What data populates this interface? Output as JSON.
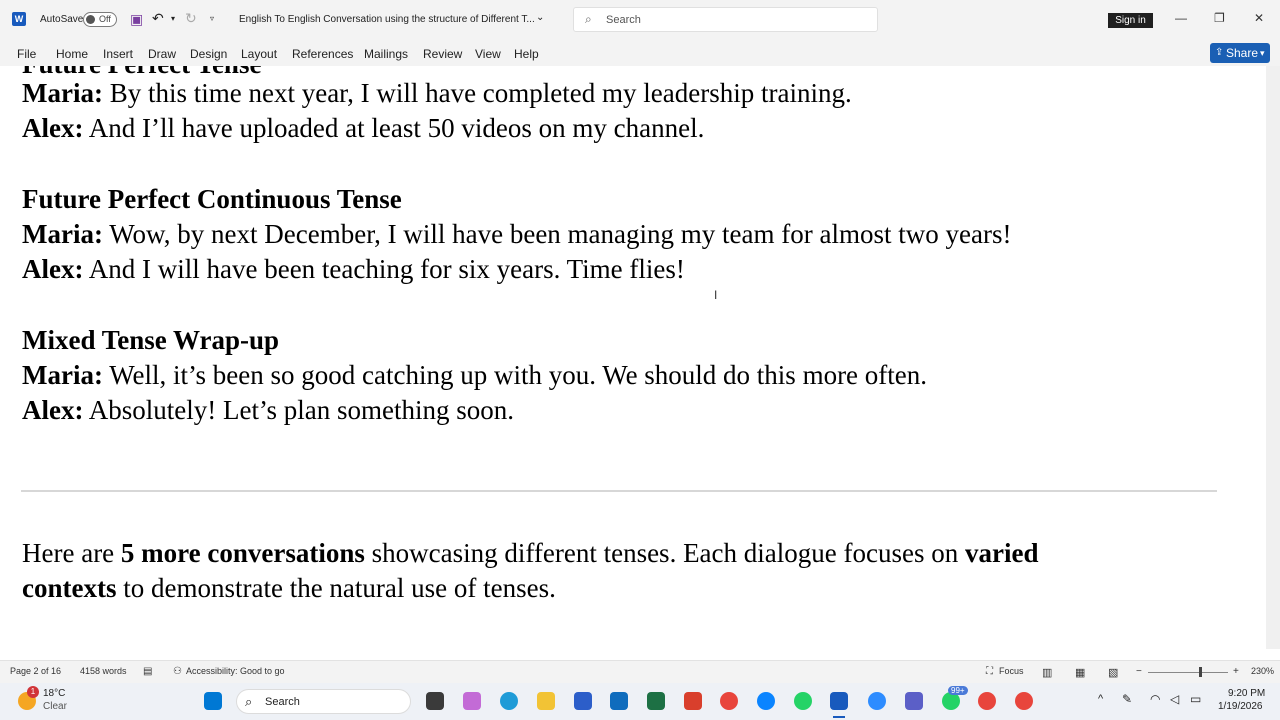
{
  "titlebar": {
    "autosave_label": "AutoSave",
    "autosave_state": "Off",
    "doc_title": "English To English Conversation using the structure of Different T...",
    "search_placeholder": "Search",
    "signin_label": "Sign in"
  },
  "menu": {
    "items": [
      "File",
      "Home",
      "Insert",
      "Draw",
      "Design",
      "Layout",
      "References",
      "Mailings",
      "Review",
      "View",
      "Help"
    ],
    "share_label": "Share"
  },
  "document": {
    "heading_partial": "Future Perfect Tense",
    "s1_line1": {
      "speaker": "Maria:",
      "text": " By this time next year, I will have completed my leadership training."
    },
    "s1_line2": {
      "speaker": "Alex:",
      "text": " And I’ll have uploaded at least 50 videos on my channel."
    },
    "heading2": "Future Perfect Continuous Tense",
    "s2_line1": {
      "speaker": "Maria:",
      "text": " Wow, by next December, I will have been managing my team for almost two years!"
    },
    "s2_line2": {
      "speaker": "Alex:",
      "text": " And I will have been teaching for six years. Time flies!"
    },
    "heading3": "Mixed Tense Wrap-up",
    "s3_line1": {
      "speaker": "Maria:",
      "text": " Well, it’s been so good catching up with you. We should do this more often."
    },
    "s3_line2": {
      "speaker": "Alex:",
      "text": " Absolutely! Let’s plan something soon."
    },
    "intro": {
      "p1": "Here are ",
      "b1": "5 more conversations",
      "p2": " showcasing different tenses. Each dialogue focuses on ",
      "b2": "varied",
      "b3": "contexts",
      "p3": " to demonstrate the natural use of tenses."
    }
  },
  "status": {
    "page": "Page 2 of 16",
    "words": "4158 words",
    "accessibility": "Accessibility: Good to go",
    "focus": "Focus",
    "zoom": "230%",
    "zoom_level": 2.3
  },
  "taskbar": {
    "weather_temp": "18°C",
    "weather_desc": "Clear",
    "weather_badge": "1",
    "search_label": "Search",
    "whatsapp_badge": "99+",
    "time": "9:20 PM",
    "date": "1/19/2026"
  },
  "colors": {
    "word_blue": "#185abd",
    "share_blue": "#1a5fb4",
    "chrome_bg": "#f3f3f3"
  }
}
